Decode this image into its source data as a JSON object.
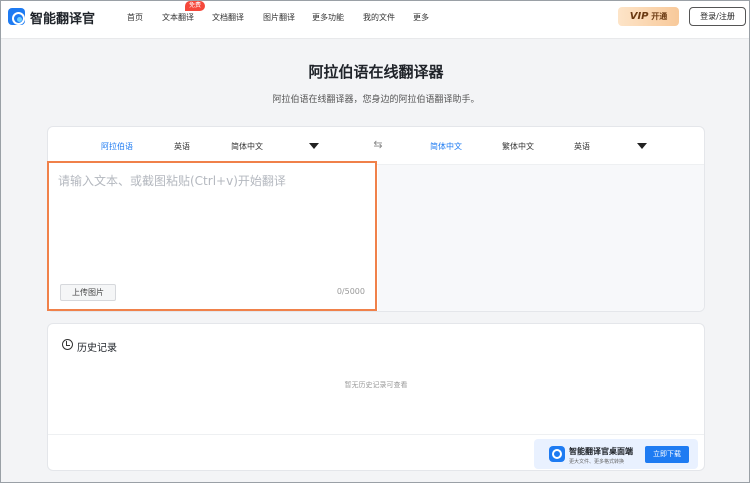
{
  "brand": {
    "name": "智能翻译官",
    "accent": "#1e7bf2"
  },
  "nav": {
    "items": [
      "首页",
      "文本翻译",
      "文档翻译",
      "图片翻译",
      "更多功能",
      "我的文件",
      "更多"
    ],
    "free_badge": "免费",
    "vip_label": "VIP",
    "vip_action": "开通",
    "login": "登录/注册"
  },
  "hero": {
    "title": "阿拉伯语在线翻译器",
    "subtitle": "阿拉伯语在线翻译器，您身边的阿拉伯语翻译助手。"
  },
  "translator": {
    "source_langs": [
      "阿拉伯语",
      "英语",
      "简体中文"
    ],
    "source_active": 0,
    "target_langs": [
      "简体中文",
      "繁体中文",
      "英语"
    ],
    "target_active": 0,
    "input_placeholder": "请输入文本、或截图粘贴(Ctrl+v)开始翻译",
    "input_value": "",
    "upload_label": "上传图片",
    "char_count": "0/5000",
    "focus_color": "#f0814a"
  },
  "history": {
    "title": "历史记录",
    "empty_text": "暂无历史记录可查看"
  },
  "app_promo": {
    "title": "智能翻译官桌面端",
    "subtitle": "更大文件、更多格式转换",
    "download_label": "立即下载"
  }
}
